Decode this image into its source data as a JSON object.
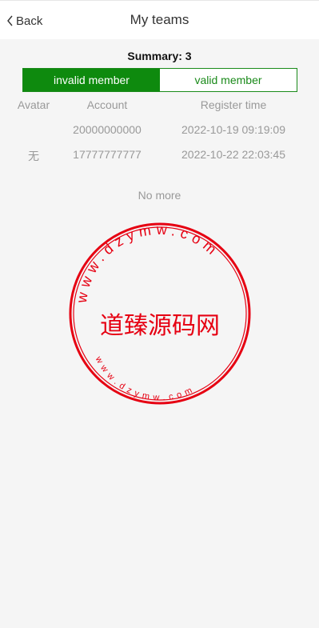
{
  "header": {
    "back_label": "Back",
    "title": "My teams"
  },
  "summary": "Summary: 3",
  "tabs": [
    {
      "label": "invalid member",
      "active": true
    },
    {
      "label": "valid member",
      "active": false
    }
  ],
  "table": {
    "columns": [
      "Avatar",
      "Account",
      "Register time"
    ],
    "rows": [
      {
        "avatar": "",
        "account": "20000000000",
        "register_time": "2022-10-19 09:19:09"
      },
      {
        "avatar": "无",
        "account": "17777777777",
        "register_time": "2022-10-22 22:03:45"
      }
    ]
  },
  "footer": {
    "no_more": "No more"
  },
  "watermark": {
    "center_text": "道臻源码网",
    "ring_text_outer": "www.dzymw.com",
    "ring_text_inner": "www.dzymw.com",
    "color": "#e60012"
  },
  "colors": {
    "accent": "#0e8a0e",
    "background": "#f5f5f5"
  }
}
